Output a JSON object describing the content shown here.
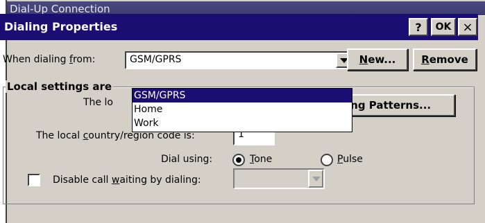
{
  "background_window": {
    "title": "Dial-Up Connection"
  },
  "dialog": {
    "title": "Dialing Properties",
    "help_button": "?",
    "ok_button": "OK",
    "close_button": "×"
  },
  "dialing_from": {
    "label_pre": "When dialing ",
    "label_accel": "f",
    "label_post": "rom:",
    "selected_value": "GSM/GPRS",
    "options": [
      "GSM/GPRS",
      "Home",
      "Work"
    ],
    "selected_index": 0
  },
  "buttons": {
    "new_accel": "N",
    "new_rest": "ew...",
    "remove_accel": "R",
    "remove_rest": "emove",
    "patterns_visible": "ling Patterns..."
  },
  "local_settings": {
    "group_title_visible": "Local settings are",
    "area_label_visible": "The lo",
    "country_label_pre": "The local ",
    "country_label_accel": "c",
    "country_label_post": "ountry/region code is:",
    "country_code": "1",
    "dial_using_label": "Dial using:",
    "tone_accel": "T",
    "tone_rest": "one",
    "pulse_accel": "P",
    "pulse_rest": "ulse",
    "dial_mode": "tone",
    "call_waiting_pre": "Disable call ",
    "call_waiting_accel": "w",
    "call_waiting_post": "aiting by dialing:",
    "call_waiting_checked": false
  },
  "colors": {
    "titlebar": "#1a0e73",
    "face": "#d4d0c8",
    "selection": "#1a0e73"
  }
}
